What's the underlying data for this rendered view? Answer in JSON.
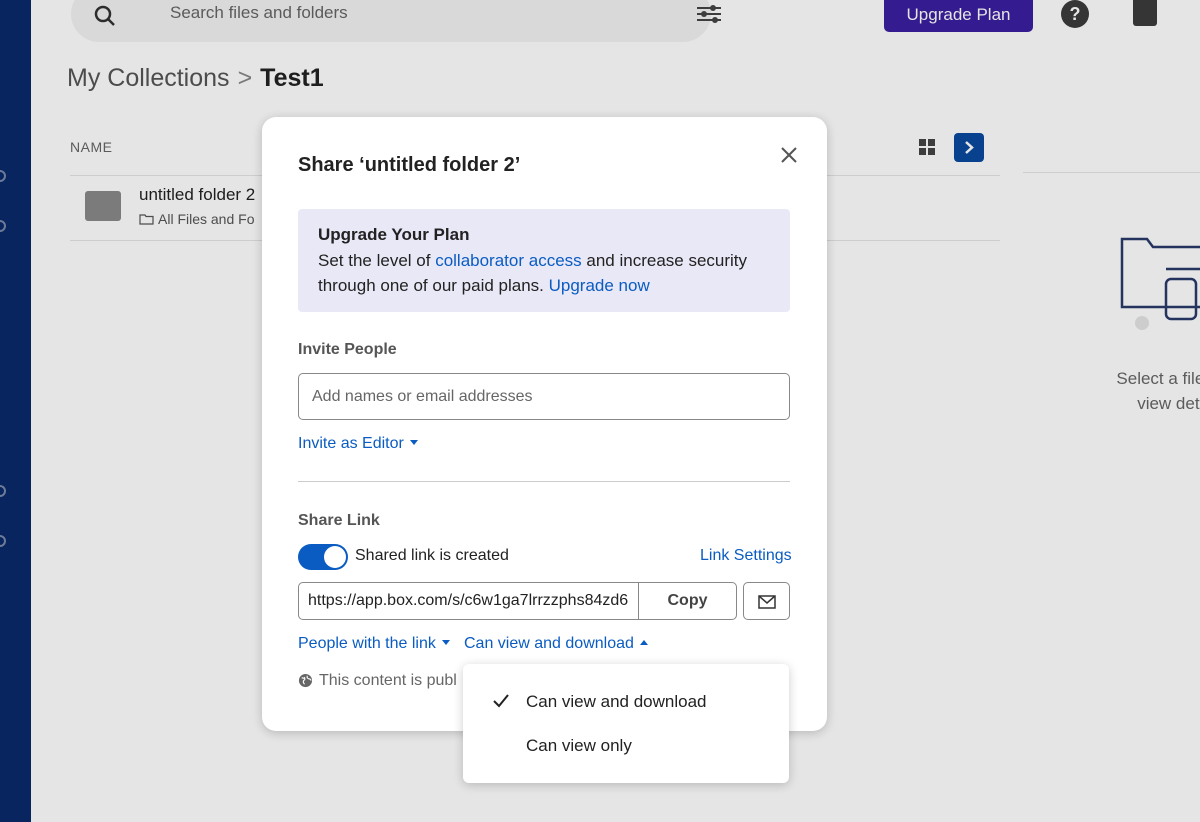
{
  "header": {
    "search_placeholder": "Search files and folders",
    "upgrade_button": "Upgrade Plan",
    "help_label": "?"
  },
  "breadcrumb": {
    "root": "My Collections",
    "separator": ">",
    "current": "Test1"
  },
  "list": {
    "column_name": "NAME",
    "items": [
      {
        "name": "untitled folder 2",
        "path": "All Files and Fo"
      }
    ]
  },
  "right_panel": {
    "line1": "Select a file or f",
    "line2": "view detai"
  },
  "modal": {
    "title": "Share ‘untitled folder 2’",
    "upgrade": {
      "heading": "Upgrade Your Plan",
      "text_before": "Set the level of ",
      "link1": "collaborator access",
      "text_mid": " and increase security through one of our paid plans. ",
      "link2": "Upgrade now"
    },
    "invite_label": "Invite People",
    "invite_placeholder": "Add names or email addresses",
    "invite_as": "Invite as Editor",
    "share_label": "Share Link",
    "toggle_on": true,
    "shared_text": "Shared link is created",
    "link_settings": "Link Settings",
    "url": "https://app.box.com/s/c6w1ga7lrrzzphs84zd6",
    "copy": "Copy",
    "people_dropdown": "People with the link",
    "permission_dropdown": "Can view and download",
    "public_note": "This content is publ"
  },
  "permission_menu": {
    "selected": "Can view and download",
    "options": [
      "Can view and download",
      "Can view only"
    ]
  },
  "colors": {
    "accent": "#0a5cc2",
    "upgrade_bg": "#e9e8f7",
    "upgrade_button": "#3a1fa0",
    "sidebar": "#0a2a6b"
  }
}
